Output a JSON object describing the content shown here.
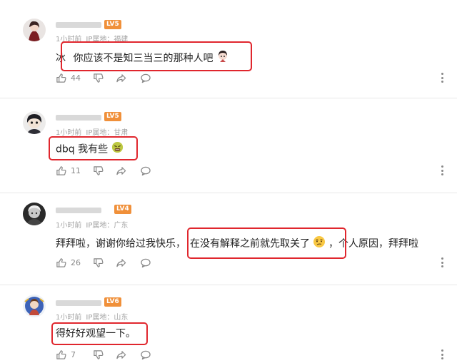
{
  "colors": {
    "highlight": "#e0262d",
    "level_badge": "#f0903a",
    "meta_text": "#a3a3a3"
  },
  "comments": [
    {
      "level": "LV5",
      "time": "1小时前",
      "ip": "IP属地：福建",
      "text_prefix": "冰",
      "text_highlight": "你应该不是知三当三的那种人吧",
      "likes": "44",
      "icons": [
        "thumbs-up-icon",
        "thumbs-down-icon",
        "share-icon",
        "comment-icon",
        "more-icon"
      ]
    },
    {
      "level": "LV5",
      "time": "1小时前",
      "ip": "IP属地：甘肃",
      "text_highlight": "dbq 我有些",
      "likes": "11",
      "icons": [
        "thumbs-up-icon",
        "thumbs-down-icon",
        "share-icon",
        "comment-icon",
        "more-icon"
      ]
    },
    {
      "level": "LV4",
      "time": "1小时前",
      "ip": "IP属地：广东",
      "text_prefix": "拜拜啦，谢谢你给过我快乐，",
      "text_highlight": "在没有解释之前就先取关了",
      "text_suffix": "，个人原因，拜拜啦",
      "likes": "26",
      "icons": [
        "thumbs-up-icon",
        "thumbs-down-icon",
        "share-icon",
        "comment-icon",
        "more-icon"
      ]
    },
    {
      "level": "LV6",
      "time": "1小时前",
      "ip": "IP属地：山东",
      "text_highlight": "得好好观望一下。",
      "likes": "7",
      "icons": [
        "thumbs-up-icon",
        "thumbs-down-icon",
        "share-icon",
        "comment-icon",
        "more-icon"
      ]
    }
  ]
}
